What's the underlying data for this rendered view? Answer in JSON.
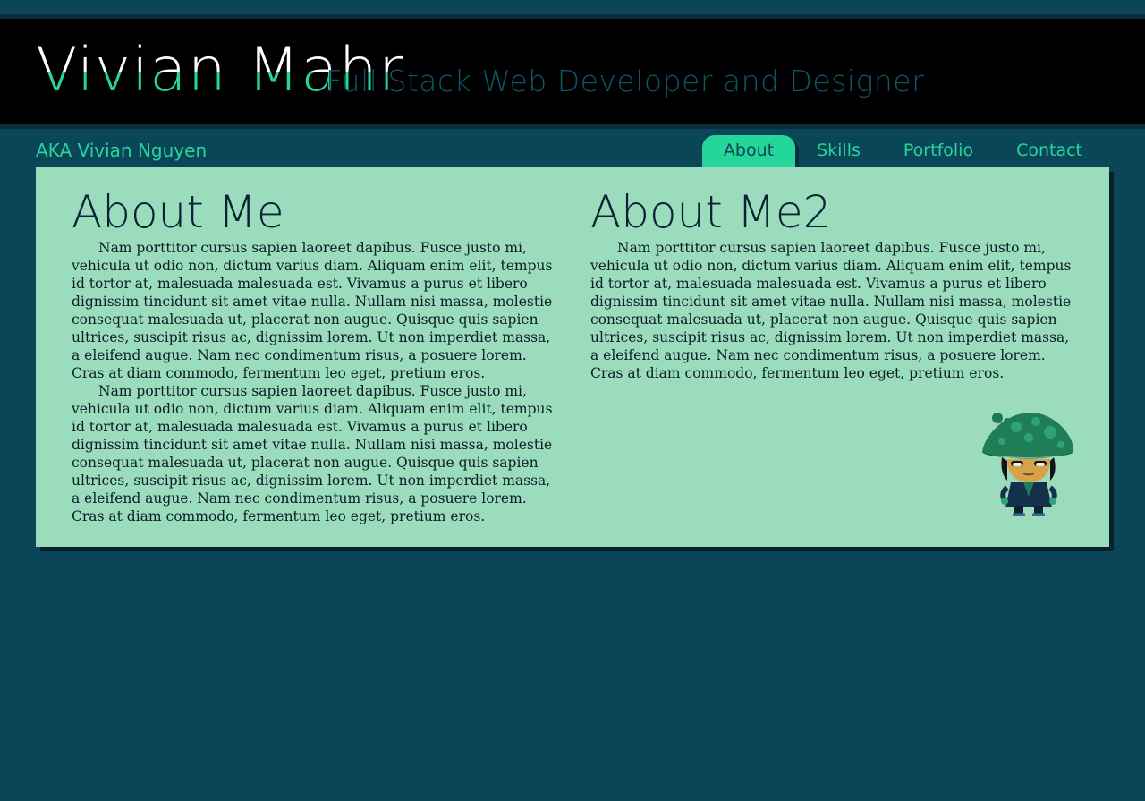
{
  "header": {
    "name": "Vivian Mahr",
    "tagline": "Full Stack Web Developer and Designer",
    "aka": "AKA Vivian Nguyen"
  },
  "nav": {
    "items": [
      {
        "label": "About",
        "active": true
      },
      {
        "label": "Skills",
        "active": false
      },
      {
        "label": "Portfolio",
        "active": false
      },
      {
        "label": "Contact",
        "active": false
      }
    ]
  },
  "main": {
    "left": {
      "heading": "About Me",
      "paragraphs": [
        "Nam porttitor cursus sapien laoreet dapibus. Fusce justo mi, vehicula ut odio non, dictum varius diam. Aliquam enim elit, tempus id tortor at, malesuada malesuada est. Vivamus a purus et libero dignissim tincidunt sit amet vitae nulla. Nullam nisi massa, molestie consequat malesuada ut, placerat non augue. Quisque quis sapien ultrices, suscipit risus ac, dignissim lorem. Ut non imperdiet massa, a eleifend augue. Nam nec condimentum risus, a posuere lorem. Cras at diam commodo, fermentum leo eget, pretium eros.",
        "Nam porttitor cursus sapien laoreet dapibus. Fusce justo mi, vehicula ut odio non, dictum varius diam. Aliquam enim elit, tempus id tortor at, malesuada malesuada est. Vivamus a purus et libero dignissim tincidunt sit amet vitae nulla. Nullam nisi massa, molestie consequat malesuada ut, placerat non augue. Quisque quis sapien ultrices, suscipit risus ac, dignissim lorem. Ut non imperdiet massa, a eleifend augue. Nam nec condimentum risus, a posuere lorem. Cras at diam commodo, fermentum leo eget, pretium eros."
      ]
    },
    "right": {
      "heading": "About Me2",
      "paragraphs": [
        "Nam porttitor cursus sapien laoreet dapibus. Fusce justo mi, vehicula ut odio non, dictum varius diam. Aliquam enim elit, tempus id tortor at, malesuada malesuada est. Vivamus a purus et libero dignissim tincidunt sit amet vitae nulla. Nullam nisi massa, molestie consequat malesuada ut, placerat non augue. Quisque quis sapien ultrices, suscipit risus ac, dignissim lorem. Ut non imperdiet massa, a eleifend augue. Nam nec condimentum risus, a posuere lorem. Cras at diam commodo, fermentum leo eget, pretium eros."
      ]
    },
    "avatar_icon": "mushroom-hat-character-icon"
  },
  "colors": {
    "page_background": "#0b4558",
    "banner_background": "#000000",
    "accent": "#25d69a",
    "tagline": "#0f5467",
    "content_background": "#9bdcbc",
    "heading_text": "#0b2236"
  }
}
